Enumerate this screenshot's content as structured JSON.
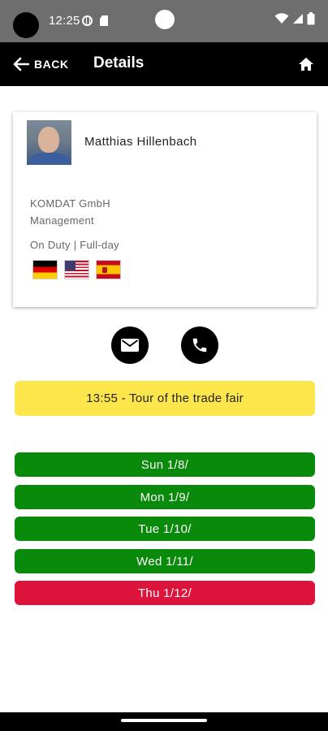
{
  "status_bar": {
    "time": "12:25"
  },
  "app_bar": {
    "back_label": "BACK",
    "title": "Details"
  },
  "contact": {
    "name": "Matthias Hillenbach",
    "company": "KOMDAT GmbH",
    "department": "Management",
    "duty": "On Duty | Full-day",
    "languages": [
      {
        "icon": "flag-germany-icon"
      },
      {
        "icon": "flag-usa-icon"
      },
      {
        "icon": "flag-spain-icon"
      }
    ]
  },
  "actions": {
    "mail_icon": "mail-icon",
    "phone_icon": "phone-icon"
  },
  "event": {
    "text": "13:55 - Tour of the trade fair",
    "color": "#fde64b"
  },
  "days": [
    {
      "label": "Sun 1/8/",
      "color": "#0a8a0a"
    },
    {
      "label": "Mon 1/9/",
      "color": "#0a8a0a"
    },
    {
      "label": "Tue 1/10/",
      "color": "#0a8a0a"
    },
    {
      "label": "Wed 1/11/",
      "color": "#0a8a0a"
    },
    {
      "label": "Thu 1/12/",
      "color": "#dc143c"
    }
  ]
}
